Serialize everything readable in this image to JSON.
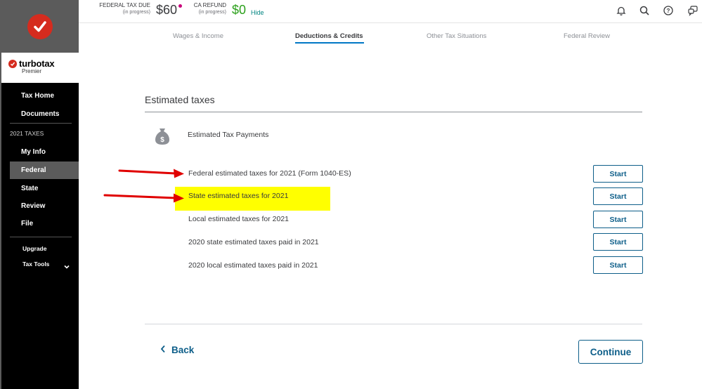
{
  "brand": {
    "name": "turbotax",
    "edition": "Premier",
    "red": "#d52b1e"
  },
  "sidebar": {
    "top_items": [
      {
        "label": "Tax Home"
      },
      {
        "label": "Documents"
      }
    ],
    "section_label": "2021 TAXES",
    "tax_items": [
      {
        "label": "My Info",
        "active": false
      },
      {
        "label": "Federal",
        "active": true
      },
      {
        "label": "State",
        "active": false
      },
      {
        "label": "Review",
        "active": false
      },
      {
        "label": "File",
        "active": false
      }
    ],
    "bottom_items": [
      {
        "label": "Upgrade"
      },
      {
        "label": "Tax Tools",
        "icon": "chevron-down-icon"
      }
    ]
  },
  "topbar": {
    "federal": {
      "label": "FEDERAL TAX DUE",
      "status": "(in progress)",
      "amount": "$60"
    },
    "state": {
      "label": "CA REFUND",
      "status": "(in progress)",
      "amount": "$0",
      "amount_color": "#2ca01c"
    },
    "hide_label": "Hide",
    "icons": [
      "bell-icon",
      "search-icon",
      "help-icon",
      "chat-icon"
    ]
  },
  "steps": [
    {
      "label": "Wages & Income",
      "active": false
    },
    {
      "label": "Deductions & Credits",
      "active": true
    },
    {
      "label": "Other Tax Situations",
      "active": false
    },
    {
      "label": "Federal Review",
      "active": false
    }
  ],
  "main": {
    "title": "Estimated taxes",
    "section_heading": "Estimated Tax Payments",
    "section_icon": "money-bag-icon",
    "rows": [
      {
        "label": "Federal estimated taxes for 2021 (Form 1040-ES)",
        "button": "Start",
        "annotated": true,
        "highlighted": false
      },
      {
        "label": "State estimated taxes for 2021",
        "button": "Start",
        "annotated": true,
        "highlighted": true
      },
      {
        "label": "Local estimated taxes for 2021",
        "button": "Start",
        "annotated": false,
        "highlighted": false
      },
      {
        "label": "2020 state estimated taxes paid in 2021",
        "button": "Start",
        "annotated": false,
        "highlighted": false
      },
      {
        "label": "2020 local estimated taxes paid in 2021",
        "button": "Start",
        "annotated": false,
        "highlighted": false
      }
    ],
    "highlight_color": "#ffff00",
    "annotation_color": "#e00000"
  },
  "footer": {
    "back_label": "Back",
    "continue_label": "Continue"
  }
}
